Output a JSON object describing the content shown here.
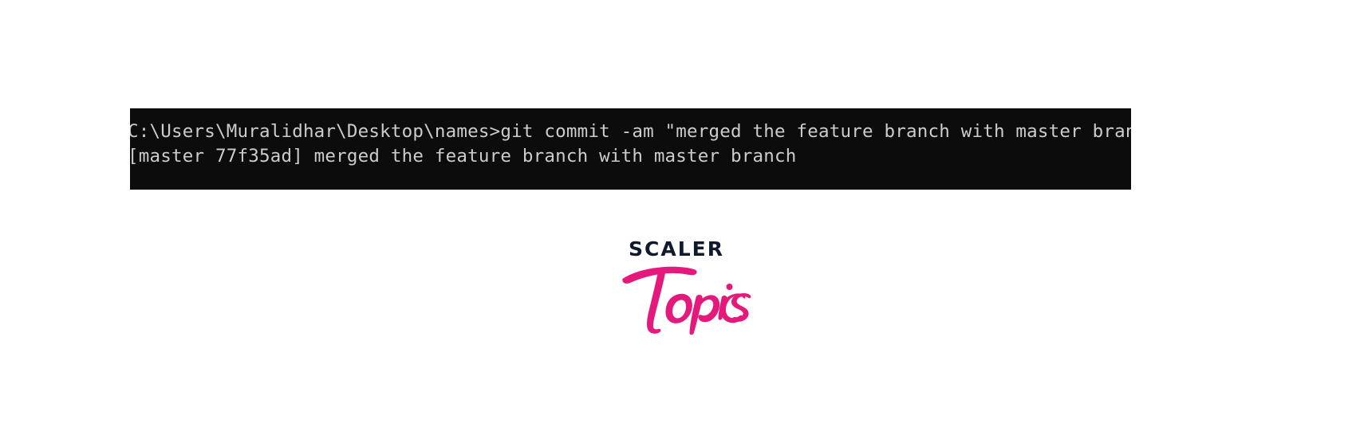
{
  "terminal": {
    "background_color": "#0c0c0c",
    "text_color": "#cccccc",
    "lines": [
      "C:\\Users\\Muralidhar\\Desktop\\names>git commit -am \"merged the feature branch with master branch\"",
      "[master 77f35ad] merged the feature branch with master branch"
    ],
    "prompt_path": "C:\\Users\\Muralidhar\\Desktop\\names",
    "command": "git commit -am \"merged the feature branch with master branch\"",
    "commit_branch": "master",
    "commit_hash": "77f35ad",
    "commit_message": "merged the feature branch with master branch"
  },
  "logo": {
    "wordmark": "SCALER",
    "script": "Topics",
    "wordmark_color": "#101a2e",
    "script_color": "#e5187c"
  }
}
